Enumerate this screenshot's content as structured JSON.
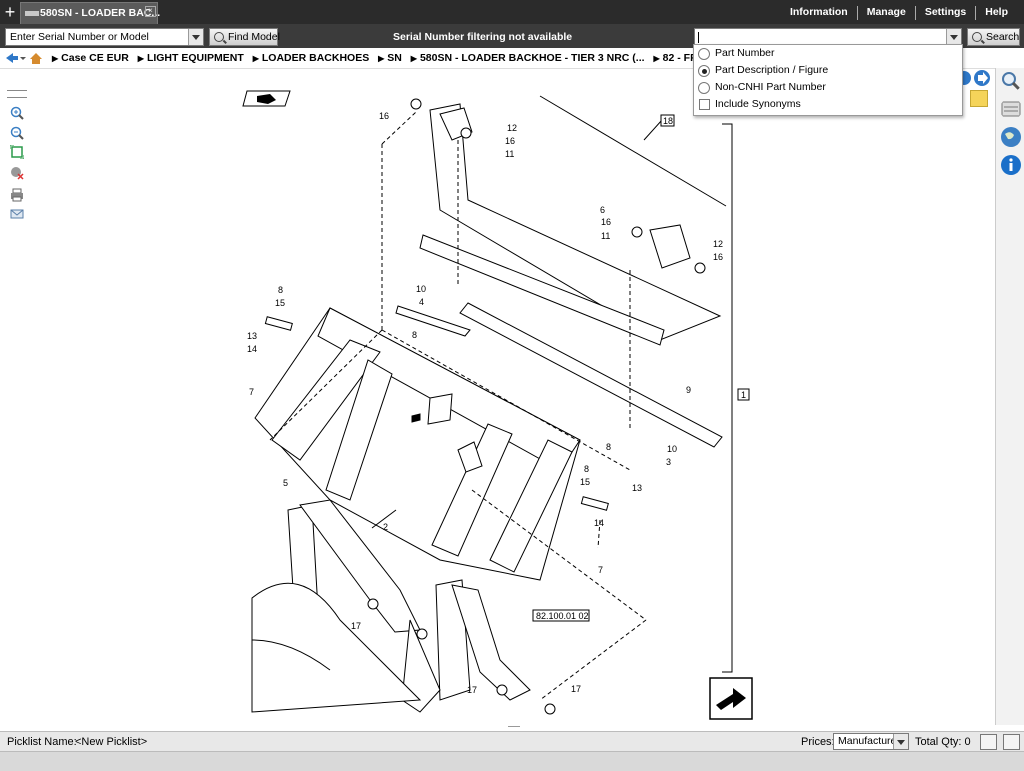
{
  "tabs": {
    "new_tab_icon": "plus-icon",
    "active": {
      "label": "580SN - LOADER BAC...",
      "close_icon": "close-icon"
    }
  },
  "top_menu": {
    "items": [
      "Information",
      "Manage",
      "Settings",
      "Help"
    ]
  },
  "search_bar": {
    "serial_placeholder": "Enter Serial Number or Model",
    "find_model_label": "Find Model",
    "serial_note": "Serial Number filtering not available",
    "search_value": "",
    "search_label": "Search"
  },
  "search_options": {
    "options": [
      {
        "label": "Part Number",
        "selected": false
      },
      {
        "label": "Part Description / Figure",
        "selected": true
      },
      {
        "label": "Non-CNHI Part Number",
        "selected": false
      }
    ],
    "include_synonyms": {
      "label": "Include Synonyms",
      "checked": false
    }
  },
  "breadcrumb": [
    "Case CE EUR",
    "LIGHT EQUIPMENT",
    "LOADER BACKHOES",
    "SN",
    "580SN - LOADER BACKHOE - TIER 3 NRC (...",
    "82 - FRONT LOADER & BUCKET"
  ],
  "diagram": {
    "callouts": [
      "16",
      "12",
      "16",
      "11",
      "18",
      "6",
      "16",
      "11",
      "12",
      "16",
      "10",
      "8",
      "15",
      "13",
      "14",
      "4",
      "8",
      "7",
      "1",
      "9",
      "10",
      "3",
      "8",
      "5",
      "8",
      "15",
      "13",
      "2",
      "14",
      "7",
      "17",
      "82.100.01 02",
      "17",
      "17"
    ]
  },
  "bottom": {
    "picklist_label": "Picklist Name:",
    "picklist_value": "<New Picklist>",
    "prices_label": "Prices:",
    "prices_value": "Manufacturer",
    "total_label": "Total Qty: 0"
  },
  "colors": {
    "topbar": "#2b2b2b",
    "searchrow": "#3b3b3b",
    "accent": "#1a6fc9"
  }
}
